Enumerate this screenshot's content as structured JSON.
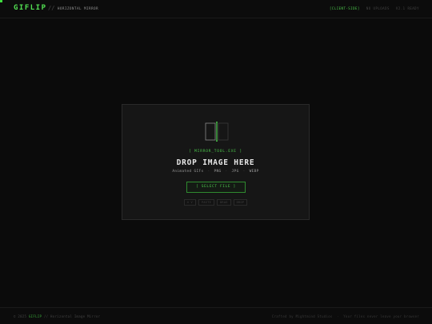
{
  "header": {
    "brand": "GIFLIP",
    "separator": "//",
    "subtitle": "HORIZONTAL MIRROR",
    "links": [
      "[CLIENT-SIDE]",
      "NO UPLOADS",
      "V2.1 READY"
    ]
  },
  "dropzone": {
    "tool_label": "[ MIRROR_TOOL.EXE ]",
    "title": "DROP IMAGE HERE",
    "formats": [
      "Animated GIFs",
      "PNG",
      "JPG",
      "WEBP"
    ],
    "select_label": "[ SELECT FILE ]",
    "shortcuts": [
      "⌘ V",
      "PASTE",
      "DRAG",
      "DROP"
    ]
  },
  "footer": {
    "copyright": "© 2025",
    "brand": "GIFLIP",
    "tagline": "// Horizontal Image Mirror",
    "right_1": "Crafted by Mightmind Studios",
    "right_2": "Your files never leave your browser"
  },
  "colors": {
    "accent": "#4cc94c",
    "background": "#0b0b0b",
    "panel": "#161616"
  }
}
